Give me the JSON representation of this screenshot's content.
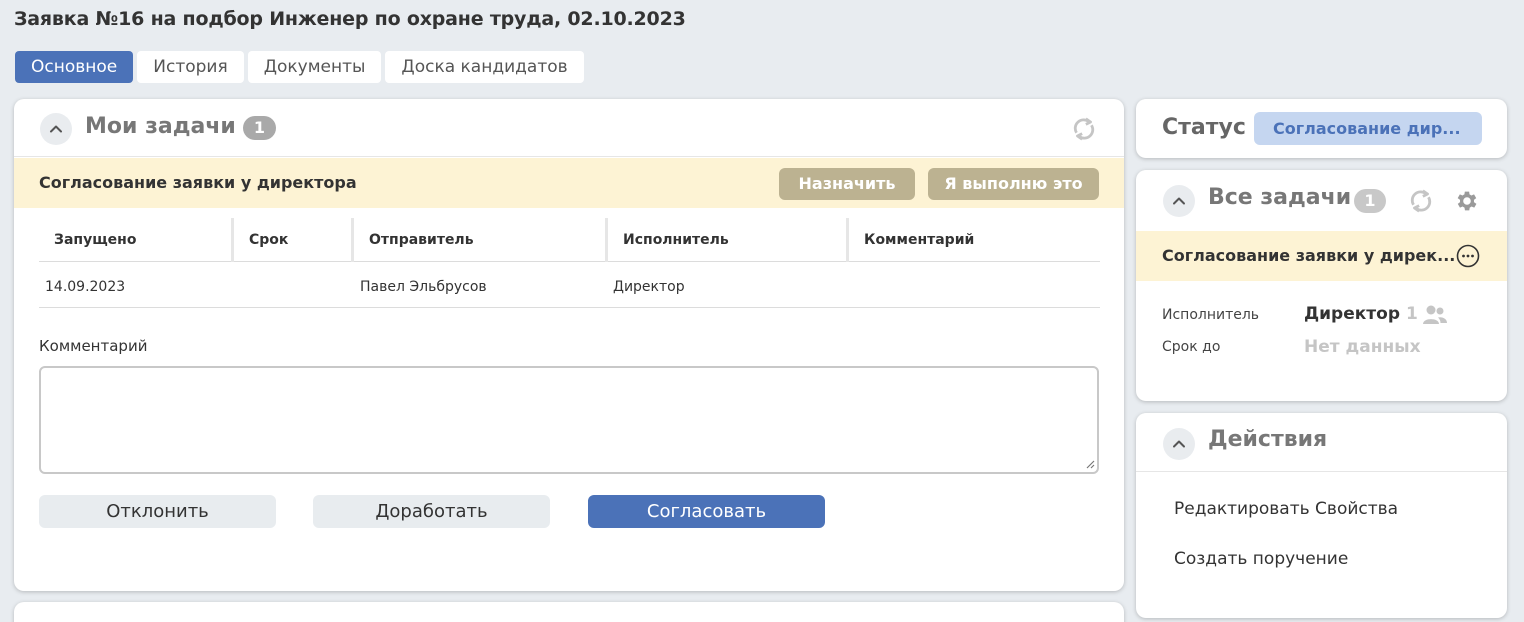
{
  "page": {
    "title": "Заявка №16 на подбор Инженер по охране труда, 02.10.2023"
  },
  "tabs": [
    {
      "label": "Основное",
      "active": true
    },
    {
      "label": "История",
      "active": false
    },
    {
      "label": "Документы",
      "active": false
    },
    {
      "label": "Доска кандидатов",
      "active": false
    }
  ],
  "my_tasks": {
    "title": "Мои задачи",
    "count": "1",
    "task_title": "Согласование заявки у директора",
    "assign_label": "Назначить",
    "do_it_label": "Я выполню это",
    "columns": [
      "Запущено",
      "Срок",
      "Отправитель",
      "Исполнитель",
      "Комментарий"
    ],
    "rows": [
      {
        "started": "14.09.2023",
        "deadline": "",
        "sender": "Павел Эльбрусов",
        "executor": "Директор",
        "comment": ""
      }
    ],
    "comment_label": "Комментарий",
    "comment_value": "",
    "reject_label": "Отклонить",
    "rework_label": "Доработать",
    "approve_label": "Согласовать"
  },
  "status": {
    "label": "Статус",
    "value": "Согласование дир..."
  },
  "all_tasks": {
    "title": "Все задачи",
    "count": "1",
    "task_title": "Согласование заявки у дирек...",
    "executor_label": "Исполнитель",
    "executor_value": "Директор",
    "executor_count": "1",
    "deadline_label": "Срок до",
    "deadline_value": "Нет данных"
  },
  "actions": {
    "title": "Действия",
    "items": [
      "Редактировать Свойства",
      "Создать поручение"
    ]
  },
  "colors": {
    "accent": "#4b72b8",
    "task_highlight": "#fdf3d4",
    "olive_button": "#bcb291",
    "status_bg": "#c5d6f0",
    "page_bg": "#e8ecf0"
  }
}
